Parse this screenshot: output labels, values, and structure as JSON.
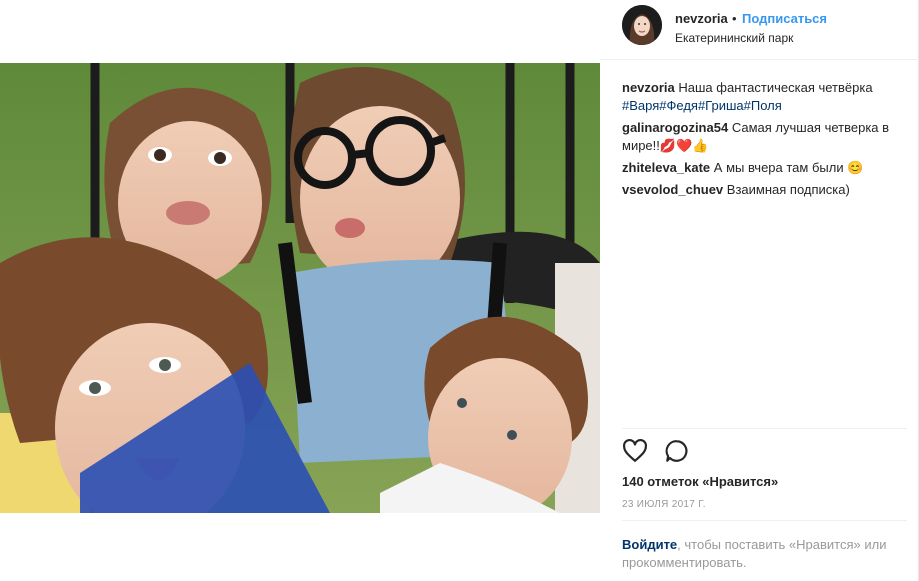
{
  "header": {
    "username": "nevzoria",
    "separator": "•",
    "follow_label": "Подписаться",
    "location": "Екатерининский парк"
  },
  "caption": {
    "user": "nevzoria",
    "text": "Наша фантастическая четвёрка",
    "tags": [
      "#Варя",
      "#Федя",
      "#Гриша",
      "#Поля"
    ]
  },
  "comments": [
    {
      "user": "galinarogozina54",
      "text": "Самая лучшая четверка в мире!!💋❤️👍"
    },
    {
      "user": "zhiteleva_kate",
      "text": "А мы вчера там были 😊"
    },
    {
      "user": "vsevolod_chuev",
      "text": "Взаимная подписка)"
    }
  ],
  "actions": {
    "like_icon": "heart-icon",
    "comment_icon": "comment-bubble-icon"
  },
  "likes": "140 отметок «Нравится»",
  "date": "23 ИЮЛЯ 2017 Г.",
  "login_prompt": {
    "link": "Войдите",
    "text": ", чтобы поставить «Нравится» или прокомментировать."
  },
  "colors": {
    "link": "#3897f0",
    "tag": "#003569",
    "muted": "#999999"
  }
}
